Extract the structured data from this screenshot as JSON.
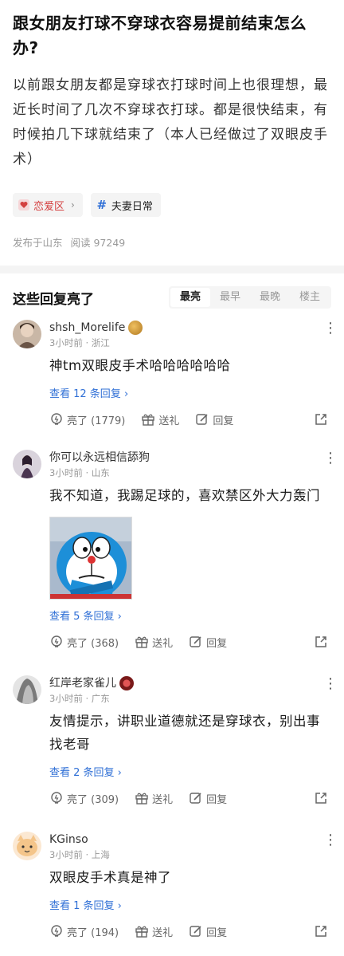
{
  "post": {
    "title": "跟女朋友打球不穿球衣容易提前结束怎么办?",
    "body": "以前跟女朋友都是穿球衣打球时间上也很理想，最近长时间了几次不穿球衣打球。都是很快结束，有时候拍几下球就结束了（本人已经做过了双眼皮手术）",
    "tags": [
      {
        "label": "恋爱区",
        "icon": "heart-icon"
      },
      {
        "label": "夫妻日常",
        "icon": "hashtag-icon"
      }
    ],
    "location": "发布于山东",
    "views_label": "阅读 97249"
  },
  "replies": {
    "title": "这些回复亮了",
    "sort_tabs": [
      "最亮",
      "最早",
      "最晚",
      "楼主"
    ],
    "active_tab": "最亮"
  },
  "comments": [
    {
      "user": "shsh_Morelife",
      "time_loc": "3小时前 · 浙江",
      "text": "神tm双眼皮手术哈哈哈哈哈哈",
      "replies_label": "查看 12 条回复",
      "likes_label": "亮了 (1779)",
      "gift_label": "送礼",
      "reply_label": "回复"
    },
    {
      "user": "你可以永远相信舔狗",
      "time_loc": "3小时前 · 山东",
      "text": "我不知道，我踢足球的，喜欢禁区外大力轰门",
      "replies_label": "查看 5 条回复",
      "likes_label": "亮了 (368)",
      "gift_label": "送礼",
      "reply_label": "回复"
    },
    {
      "user": "红岸老家雀儿",
      "time_loc": "3小时前 · 广东",
      "text": "友情提示，讲职业道德就还是穿球衣，别出事找老哥",
      "replies_label": "查看 2 条回复",
      "likes_label": "亮了 (309)",
      "gift_label": "送礼",
      "reply_label": "回复"
    },
    {
      "user": "KGinso",
      "time_loc": "3小时前 · 上海",
      "text": "双眼皮手术真是神了",
      "replies_label": "查看 1 条回复",
      "likes_label": "亮了 (194)",
      "gift_label": "送礼",
      "reply_label": "回复"
    }
  ],
  "colors": {
    "link": "#2f6fd6",
    "love_tag": "#d43f3f",
    "muted": "#999999"
  }
}
